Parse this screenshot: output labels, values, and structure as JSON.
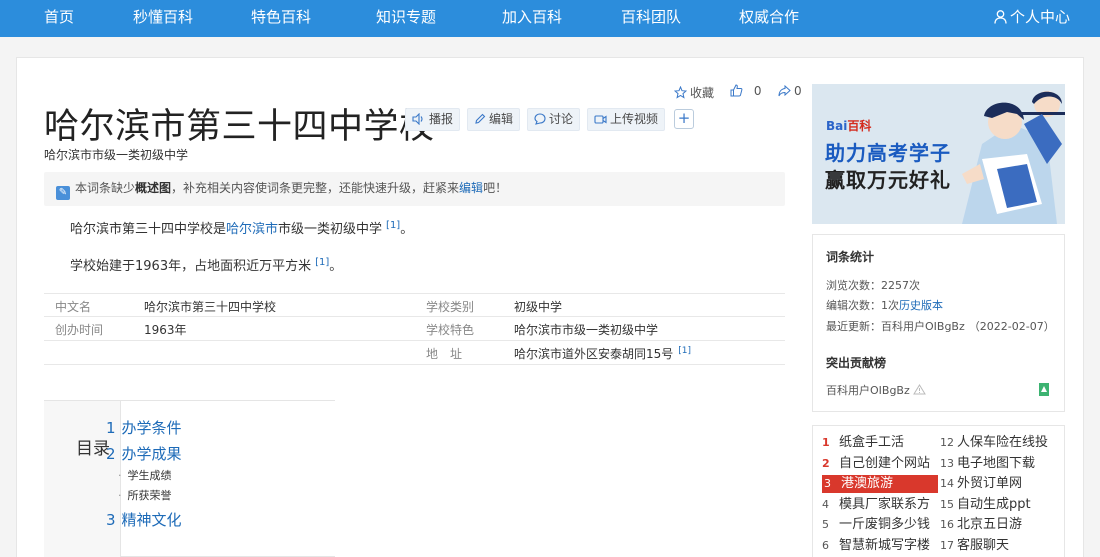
{
  "nav": {
    "items": [
      "首页",
      "秒懂百科",
      "特色百科",
      "知识专题",
      "加入百科",
      "百科团队",
      "权威合作"
    ],
    "user_center": "个人中心"
  },
  "entry": {
    "title": "哈尔滨市第三十四中学校",
    "subtitle": "哈尔滨市市级一类初级中学",
    "actions": {
      "broadcast": "播报",
      "edit": "编辑",
      "discuss": "讨论",
      "upload_video": "上传视频",
      "more": "+"
    },
    "meta": {
      "favorite": "收藏",
      "like_count": "0",
      "share_count": "0"
    },
    "notice": {
      "prefix": "本词条缺少",
      "bold": "概述图",
      "middle": "，补充相关内容使词条更完整，还能快速升级，赶紧来",
      "link": "编辑",
      "suffix": "吧！"
    },
    "paragraphs": [
      {
        "before": "哈尔滨市第三十四中学校是",
        "link": "哈尔滨市",
        "after": "市级一类初级中学",
        "ref": "[1]",
        "end": "。"
      },
      {
        "before": "学校始建于1963年，占地面积近万平方米",
        "link": "",
        "after": "",
        "ref": "[1]",
        "end": "。"
      }
    ],
    "info": [
      {
        "k1": "中文名",
        "v1": "哈尔滨市第三十四中学校",
        "k2": "学校类别",
        "v2": "初级中学",
        "ref": ""
      },
      {
        "k1": "创办时间",
        "v1": "1963年",
        "k2": "学校特色",
        "v2": "哈尔滨市市级一类初级中学",
        "ref": ""
      },
      {
        "k1": "",
        "v1": "",
        "k2": "地　址",
        "v2": "哈尔滨市道外区安泰胡同15号",
        "ref": "[1]"
      }
    ]
  },
  "toc": {
    "title": "目录",
    "items": [
      {
        "num": "1",
        "label": "办学条件"
      },
      {
        "num": "2",
        "label": "办学成果"
      },
      {
        "num": "3",
        "label": "精神文化"
      }
    ],
    "subitems": [
      "学生成绩",
      "所获荣誉"
    ]
  },
  "ad": {
    "logo_a": "Bai",
    "logo_b": "百科",
    "line1": "助力高考学子",
    "line2": "赢取万元好礼"
  },
  "stats": {
    "title": "词条统计",
    "views_label": "浏览次数：",
    "views": "2257次",
    "edits_label": "编辑次数：",
    "edits": "1次",
    "history_link": "历史版本",
    "updated_label": "最近更新：",
    "updated_user": "百科用户OIBgBz",
    "updated_date": "（2022-02-07）",
    "contrib_title": "突出贡献榜",
    "contrib_user": "百科用户OIBgBz"
  },
  "hot": {
    "left": [
      {
        "rank": "1",
        "label": "纸盒手工活"
      },
      {
        "rank": "2",
        "label": "自己创建个网站"
      },
      {
        "rank": "3",
        "label": "港澳旅游"
      },
      {
        "rank": "4",
        "label": "模具厂家联系方"
      },
      {
        "rank": "5",
        "label": "一斤废铜多少钱"
      },
      {
        "rank": "6",
        "label": "智慧新城写字楼"
      }
    ],
    "right": [
      {
        "rank": "12",
        "label": "人保车险在线投"
      },
      {
        "rank": "13",
        "label": "电子地图下载"
      },
      {
        "rank": "14",
        "label": "外贸订单网"
      },
      {
        "rank": "15",
        "label": "自动生成ppt"
      },
      {
        "rank": "16",
        "label": "北京五日游"
      },
      {
        "rank": "17",
        "label": "客服聊天"
      }
    ]
  },
  "colors": {
    "nav_bg": "#2c8ddc",
    "link": "#1e6bb8",
    "hot_active": "#d9382c"
  }
}
